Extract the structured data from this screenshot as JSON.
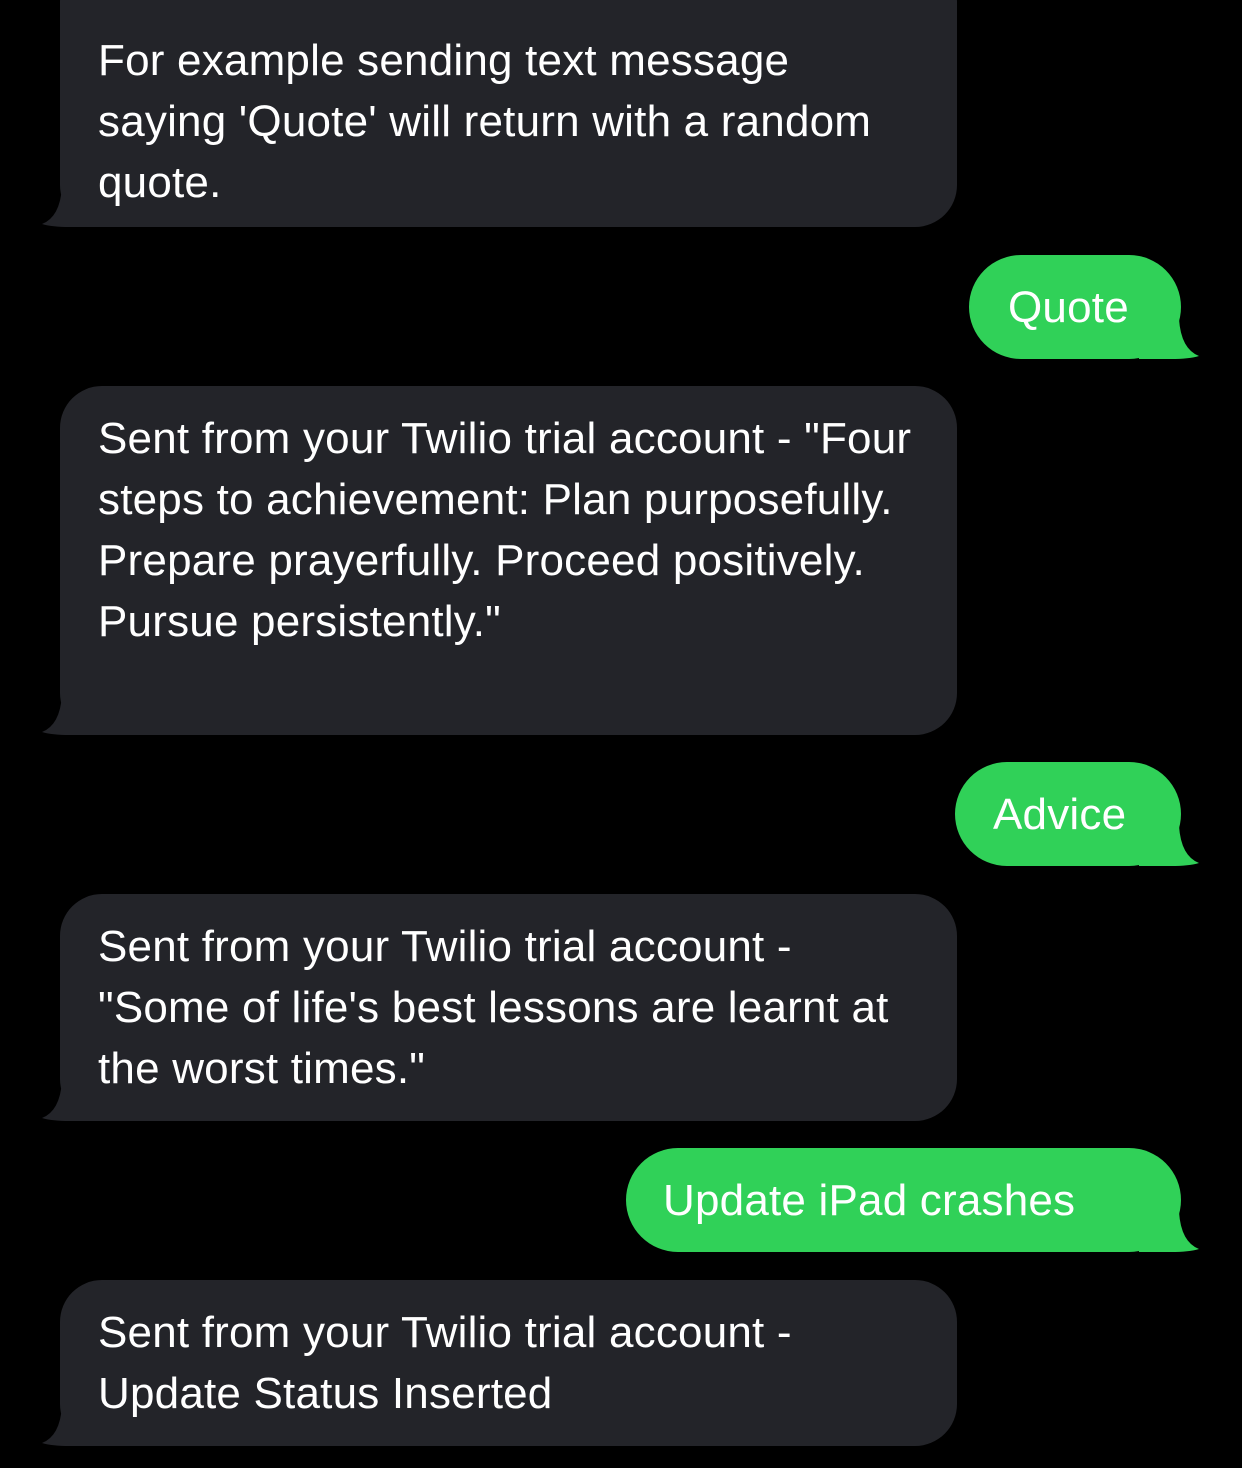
{
  "colors": {
    "background": "#000000",
    "incoming_bubble": "#232429",
    "outgoing_bubble": "#30d158",
    "text": "#ffffff"
  },
  "messages": [
    {
      "direction": "incoming",
      "text": "For example sending text message saying 'Quote' will return with a random quote."
    },
    {
      "direction": "outgoing",
      "text": "Quote"
    },
    {
      "direction": "incoming",
      "text": "Sent from your Twilio trial account - \"Four steps to achievement: Plan purposefully. Prepare prayerfully. Proceed positively. Pursue persistently.\""
    },
    {
      "direction": "outgoing",
      "text": "Advice"
    },
    {
      "direction": "incoming",
      "text": "Sent from your Twilio trial account - \"Some of life's best lessons are learnt at the worst times.\""
    },
    {
      "direction": "outgoing",
      "text": "Update iPad crashes"
    },
    {
      "direction": "incoming",
      "text": "Sent from your Twilio trial account - Update Status Inserted"
    }
  ]
}
